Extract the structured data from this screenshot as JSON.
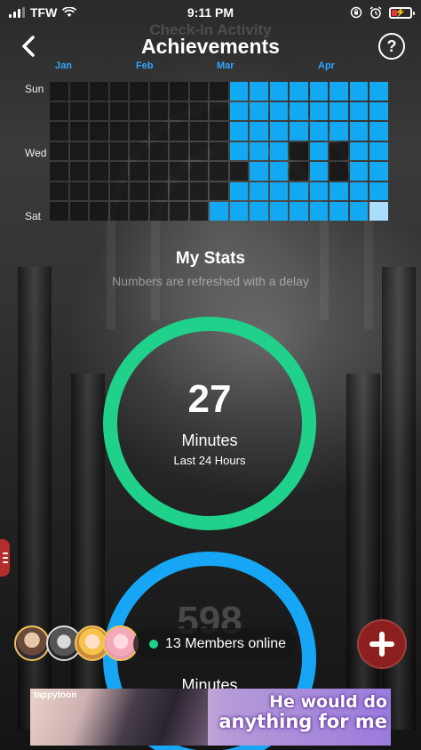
{
  "status_bar": {
    "carrier": "TFW",
    "time": "9:11 PM"
  },
  "header": {
    "title": "Achievements",
    "ghost_title": "Check-In Activity",
    "help_label": "?"
  },
  "calendar": {
    "months": [
      "Jan",
      "Feb",
      "Mar",
      "Apr"
    ],
    "day_labels": [
      "Sun",
      "Wed",
      "Sat"
    ],
    "weeks": 17,
    "days": 7,
    "active_color": "#13a8f2",
    "inactive_color": "#1a1a1a"
  },
  "stats": {
    "title": "My Stats",
    "subtitle": "Numbers are refreshed with a delay",
    "minutes_24h": {
      "value": "27",
      "unit": "Minutes",
      "period": "Last 24 Hours",
      "color": "#1fd18a"
    },
    "minutes_total": {
      "value": "598",
      "unit": "Minutes",
      "color": "#17a6f5"
    }
  },
  "members": {
    "label": "13 Members online",
    "online_color": "#1fd18a"
  },
  "fab": {
    "icon": "plus-icon",
    "color": "#8c1f1f"
  },
  "ad": {
    "brand": "tappytoon",
    "line1": "He would do",
    "line2": "anything for me"
  }
}
